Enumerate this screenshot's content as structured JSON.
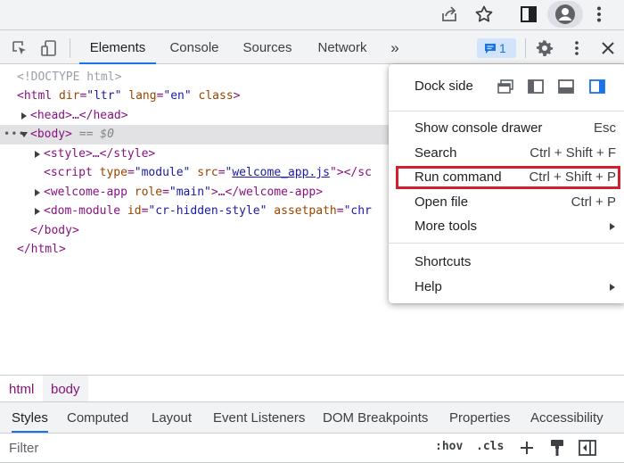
{
  "devtools": {
    "tabs": [
      "Elements",
      "Console",
      "Sources",
      "Network"
    ],
    "more_tabs_glyph": "»",
    "issues_count": "1"
  },
  "tree": {
    "doctype": "<!DOCTYPE html>",
    "html_open": {
      "tag": "<html",
      "attrs": [
        {
          "n": "dir",
          "v": "\"ltr\""
        },
        {
          "n": "lang",
          "v": "\"en\""
        },
        {
          "n": "class",
          "v": ""
        }
      ],
      "close": ">"
    },
    "head": "<head>…</head>",
    "body_open": "<body>",
    "body_eq": "== $0",
    "style": "<style>…</style>",
    "script": {
      "open": "<script",
      "type_n": "type",
      "type_v": "\"module\"",
      "src_n": "src",
      "src_v": "welcome_app.js",
      "close": "\"></sc"
    },
    "welcome_app": {
      "open": "<welcome-app",
      "role_n": "role",
      "role_v": "\"main\"",
      "rest": ">…</welcome-app>"
    },
    "dom_module": {
      "open": "<dom-module",
      "id_n": "id",
      "id_v": "\"cr-hidden-style\"",
      "ap_n": "assetpath",
      "ap_v": "\"chr"
    },
    "body_close": "</body>",
    "html_close": "</html>",
    "selected_dots": "•••"
  },
  "breadcrumbs": [
    "html",
    "body"
  ],
  "styles_tabs": [
    "Styles",
    "Computed",
    "Layout",
    "Event Listeners",
    "DOM Breakpoints",
    "Properties",
    "Accessibility"
  ],
  "filter": {
    "placeholder": "Filter",
    "hov": ":hov",
    "cls": ".cls"
  },
  "menu": {
    "dock_side_label": "Dock side",
    "items": [
      {
        "label": "Show console drawer",
        "shortcut": "Esc"
      },
      {
        "label": "Search",
        "shortcut": "Ctrl + Shift + F"
      },
      {
        "label": "Run command",
        "shortcut": "Ctrl + Shift + P",
        "highlighted": true
      },
      {
        "label": "Open file",
        "shortcut": "Ctrl + P"
      },
      {
        "label": "More tools",
        "submenu": true
      },
      {
        "label": "Shortcuts"
      },
      {
        "label": "Help",
        "submenu": true
      }
    ]
  },
  "colors": {
    "accent": "#1a73e8",
    "highlight_border": "#d01f2f",
    "tag": "#881280",
    "attr_name": "#994500",
    "attr_value": "#1a1aa6"
  }
}
